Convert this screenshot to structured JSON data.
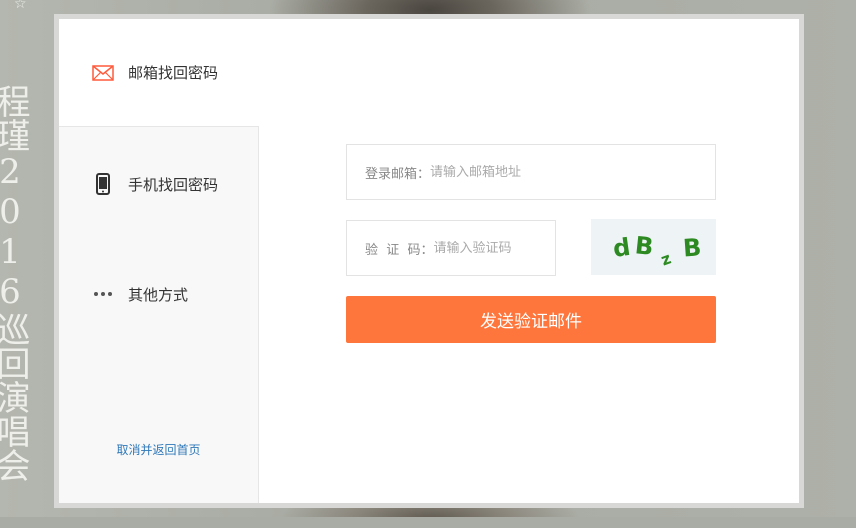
{
  "background": {
    "poster_text": "程瑾2016巡回演唱会"
  },
  "sidebar": {
    "items": [
      {
        "label": "邮箱找回密码",
        "icon": "envelope-icon"
      },
      {
        "label": "手机找回密码",
        "icon": "mobile-phone-icon"
      },
      {
        "label": "其他方式",
        "icon": "more-dots-icon"
      }
    ],
    "cancel_link": "取消并返回首页"
  },
  "form": {
    "email": {
      "label": "登录邮箱：",
      "placeholder": "请输入邮箱地址"
    },
    "captcha": {
      "label": "验  证  码：",
      "placeholder": "请输入验证码",
      "image_text": "dBzB"
    },
    "submit_label": "发送验证邮件"
  },
  "colors": {
    "accent": "#ff763c",
    "link": "#2f78b8",
    "captcha_text": "#2d8a22"
  }
}
